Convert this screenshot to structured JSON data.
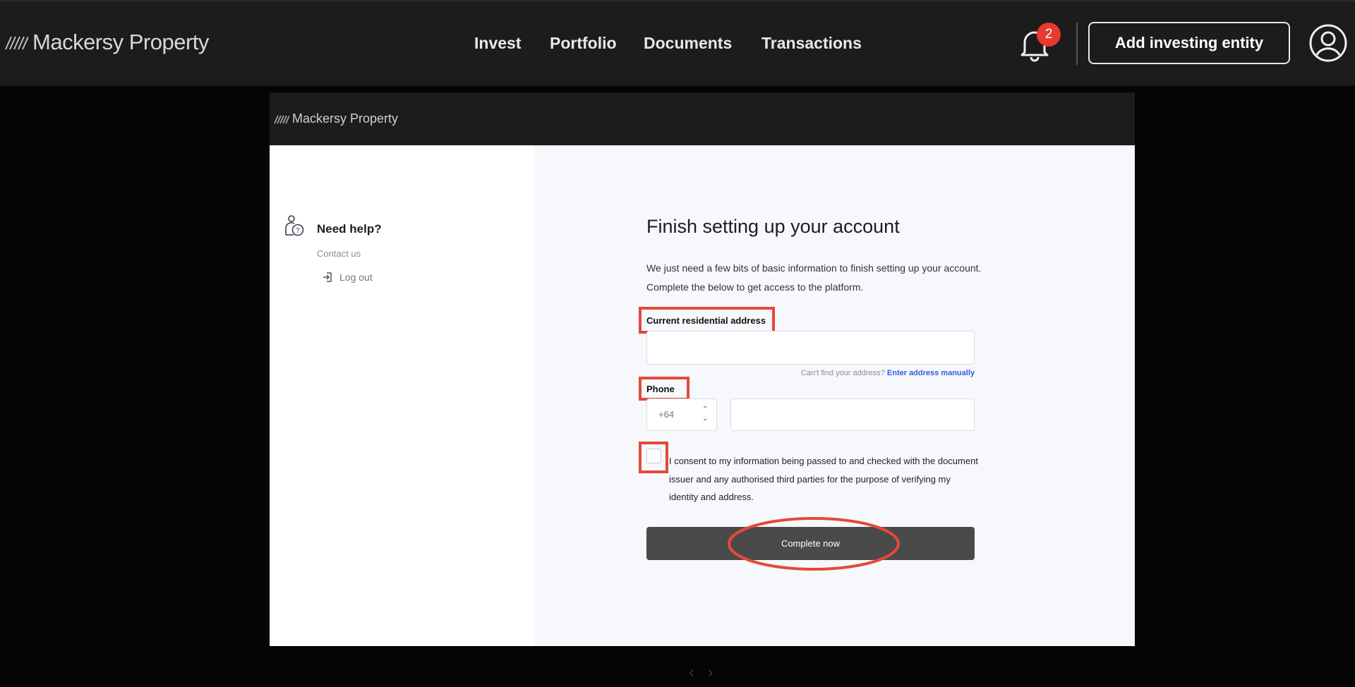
{
  "topnav": {
    "brand": "Mackersy Property",
    "items": [
      {
        "label": "Invest"
      },
      {
        "label": "Portfolio"
      },
      {
        "label": "Documents"
      },
      {
        "label": "Transactions"
      }
    ],
    "notification_count": "2",
    "add_entity_label": "Add investing entity",
    "icons": [
      "logo-stripes-icon",
      "bell-icon",
      "user-avatar-icon"
    ]
  },
  "embedded": {
    "brand": "Mackersy Property",
    "sidebar": {
      "help_title": "Need help?",
      "contact": "Contact us",
      "logout": "Log out"
    },
    "form": {
      "title": "Finish setting up your account",
      "intro": "We just need a few bits of basic information to finish setting up your account. Complete the below to get access to the platform.",
      "address_label": "Current residential address",
      "address_value": "",
      "address_hint": "Can't find your address?",
      "address_manual_link": "Enter address manually",
      "phone_label": "Phone",
      "country_code": "+64",
      "phone_value": "",
      "consent_checked": false,
      "consent_text": "I consent to my information being passed to and checked with the document issuer and any authorised third parties for the purpose of verifying my identity and address.",
      "submit_label": "Complete now"
    }
  },
  "colors": {
    "nav_bg": "#1c1c1c",
    "badge": "#e8392f",
    "highlight": "#e5493a",
    "link": "#2f5bea",
    "button": "#4a4a4a",
    "panel": "#f7f8fc"
  }
}
